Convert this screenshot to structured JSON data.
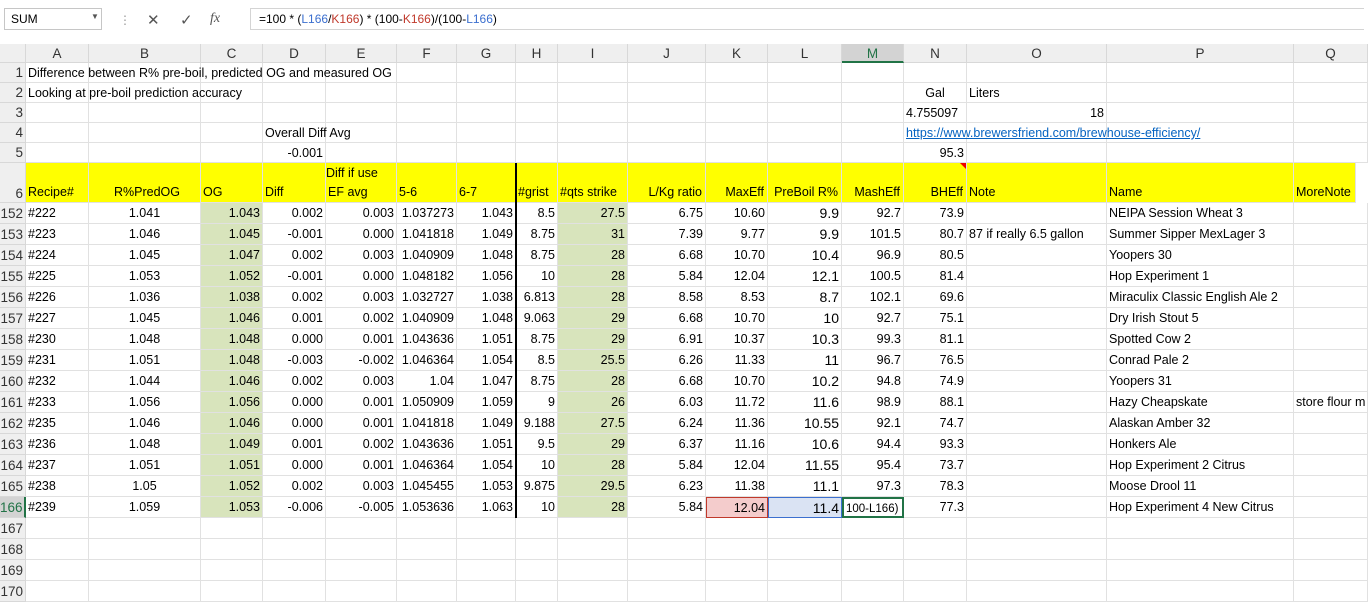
{
  "namebox": "SUM",
  "formula_bar": {
    "cancel": "✕",
    "enter": "✓",
    "fx": "fx",
    "formula_parts": [
      "=100 * (",
      "L166",
      "/",
      "K166",
      ") * (100-",
      "K166",
      ")/(100-",
      "L166",
      ")"
    ]
  },
  "columns": [
    "A",
    "B",
    "C",
    "D",
    "E",
    "F",
    "G",
    "H",
    "I",
    "J",
    "K",
    "L",
    "M",
    "N",
    "O",
    "P",
    "Q"
  ],
  "rows_top": [
    {
      "num": "1",
      "cells": {
        "A": "Difference between R% pre-boil, predicted OG and measured OG"
      }
    },
    {
      "num": "2",
      "cells": {
        "A": "Looking at pre-boil prediction accuracy"
      }
    },
    {
      "num": "3",
      "cells": {
        "N": "Gal",
        "O": "Liters"
      }
    },
    {
      "num": "4",
      "cells": {
        "N": "4.755097",
        "O": "18"
      }
    },
    {
      "num": "5",
      "cells": {
        "D": "Overall Diff Avg",
        "N": "https://www.brewersfriend.com/brewhouse-efficiency/"
      }
    },
    {
      "num": "6",
      "cells": {
        "D": "-0.001",
        "N": "95.3"
      }
    }
  ],
  "header_row": {
    "num": "6",
    "diff_if_use": "Diff if use",
    "labels": {
      "A": "Recipe#",
      "B": "R%PredOG",
      "C": "OG",
      "D": "Diff",
      "E": "EF avg",
      "F": "5-6",
      "G": "6-7",
      "H": "#grist",
      "I": "#qts strike",
      "J": "L/Kg ratio",
      "K": "MaxEff",
      "L": "PreBoil R%",
      "M": "MashEff",
      "N": "BHEff",
      "O": "Note",
      "P": "Name",
      "Q": "MoreNote"
    }
  },
  "data_rows": [
    {
      "num": "152",
      "A": "#222",
      "B": "1.041",
      "C": "1.043",
      "D": "0.002",
      "E": "0.003",
      "F": "1.037273",
      "G": "1.043",
      "H": "8.5",
      "I": "27.5",
      "J": "6.75",
      "K": "10.60",
      "L": "9.9",
      "M": "92.7",
      "N": "73.9",
      "O": "",
      "P": "NEIPA Session Wheat 3",
      "Q": ""
    },
    {
      "num": "153",
      "A": "#223",
      "B": "1.046",
      "C": "1.045",
      "D": "-0.001",
      "E": "0.000",
      "F": "1.041818",
      "G": "1.049",
      "H": "8.75",
      "I": "31",
      "J": "7.39",
      "K": "9.77",
      "L": "9.9",
      "M": "101.5",
      "N": "80.7",
      "O": "87 if really 6.5 gallon",
      "P": "Summer Sipper MexLager 3",
      "Q": ""
    },
    {
      "num": "154",
      "A": "#224",
      "B": "1.045",
      "C": "1.047",
      "D": "0.002",
      "E": "0.003",
      "F": "1.040909",
      "G": "1.048",
      "H": "8.75",
      "I": "28",
      "J": "6.68",
      "K": "10.70",
      "L": "10.4",
      "M": "96.9",
      "N": "80.5",
      "O": "",
      "P": "Yoopers 30",
      "Q": ""
    },
    {
      "num": "155",
      "A": "#225",
      "B": "1.053",
      "C": "1.052",
      "D": "-0.001",
      "E": "0.000",
      "F": "1.048182",
      "G": "1.056",
      "H": "10",
      "I": "28",
      "J": "5.84",
      "K": "12.04",
      "L": "12.1",
      "M": "100.5",
      "N": "81.4",
      "O": "",
      "P": "Hop Experiment 1",
      "Q": ""
    },
    {
      "num": "156",
      "A": "#226",
      "B": "1.036",
      "C": "1.038",
      "D": "0.002",
      "E": "0.003",
      "F": "1.032727",
      "G": "1.038",
      "H": "6.813",
      "I": "28",
      "J": "8.58",
      "K": "8.53",
      "L": "8.7",
      "M": "102.1",
      "N": "69.6",
      "O": "",
      "P": "Miraculix Classic English Ale 2",
      "Q": ""
    },
    {
      "num": "157",
      "A": "#227",
      "B": "1.045",
      "C": "1.046",
      "D": "0.001",
      "E": "0.002",
      "F": "1.040909",
      "G": "1.048",
      "H": "9.063",
      "I": "29",
      "J": "6.68",
      "K": "10.70",
      "L": "10",
      "M": "92.7",
      "N": "75.1",
      "O": "",
      "P": "Dry Irish Stout 5",
      "Q": ""
    },
    {
      "num": "158",
      "A": "#230",
      "B": "1.048",
      "C": "1.048",
      "D": "0.000",
      "E": "0.001",
      "F": "1.043636",
      "G": "1.051",
      "H": "8.75",
      "I": "29",
      "J": "6.91",
      "K": "10.37",
      "L": "10.3",
      "M": "99.3",
      "N": "81.1",
      "O": "",
      "P": "Spotted Cow 2",
      "Q": ""
    },
    {
      "num": "159",
      "A": "#231",
      "B": "1.051",
      "C": "1.048",
      "D": "-0.003",
      "E": "-0.002",
      "F": "1.046364",
      "G": "1.054",
      "H": "8.5",
      "I": "25.5",
      "J": "6.26",
      "K": "11.33",
      "L": "11",
      "M": "96.7",
      "N": "76.5",
      "O": "",
      "P": "Conrad Pale 2",
      "Q": ""
    },
    {
      "num": "160",
      "A": "#232",
      "B": "1.044",
      "C": "1.046",
      "D": "0.002",
      "E": "0.003",
      "F": "1.04",
      "G": "1.047",
      "H": "8.75",
      "I": "28",
      "J": "6.68",
      "K": "10.70",
      "L": "10.2",
      "M": "94.8",
      "N": "74.9",
      "O": "",
      "P": "Yoopers 31",
      "Q": ""
    },
    {
      "num": "161",
      "A": "#233",
      "B": "1.056",
      "C": "1.056",
      "D": "0.000",
      "E": "0.001",
      "F": "1.050909",
      "G": "1.059",
      "H": "9",
      "I": "26",
      "J": "6.03",
      "K": "11.72",
      "L": "11.6",
      "M": "98.9",
      "N": "88.1",
      "O": "",
      "P": "Hazy Cheapskate",
      "Q": "store flour m"
    },
    {
      "num": "162",
      "A": "#235",
      "B": "1.046",
      "C": "1.046",
      "D": "0.000",
      "E": "0.001",
      "F": "1.041818",
      "G": "1.049",
      "H": "9.188",
      "I": "27.5",
      "J": "6.24",
      "K": "11.36",
      "L": "10.55",
      "M": "92.1",
      "N": "74.7",
      "O": "",
      "P": "Alaskan Amber 32",
      "Q": ""
    },
    {
      "num": "163",
      "A": "#236",
      "B": "1.048",
      "C": "1.049",
      "D": "0.001",
      "E": "0.002",
      "F": "1.043636",
      "G": "1.051",
      "H": "9.5",
      "I": "29",
      "J": "6.37",
      "K": "11.16",
      "L": "10.6",
      "M": "94.4",
      "N": "93.3",
      "O": "",
      "P": "Honkers Ale",
      "Q": ""
    },
    {
      "num": "164",
      "A": "#237",
      "B": "1.051",
      "C": "1.051",
      "D": "0.000",
      "E": "0.001",
      "F": "1.046364",
      "G": "1.054",
      "H": "10",
      "I": "28",
      "J": "5.84",
      "K": "12.04",
      "L": "11.55",
      "M": "95.4",
      "N": "73.7",
      "O": "",
      "P": "Hop Experiment 2 Citrus",
      "Q": ""
    },
    {
      "num": "165",
      "A": "#238",
      "B": "1.05",
      "C": "1.052",
      "D": "0.002",
      "E": "0.003",
      "F": "1.045455",
      "G": "1.053",
      "H": "9.875",
      "I": "29.5",
      "J": "6.23",
      "K": "11.38",
      "L": "11.1",
      "M": "97.3",
      "N": "78.3",
      "O": "",
      "P": "Moose Drool 11",
      "Q": ""
    },
    {
      "num": "166",
      "A": "#239",
      "B": "1.059",
      "C": "1.053",
      "D": "-0.006",
      "E": "-0.005",
      "F": "1.053636",
      "G": "1.063",
      "H": "10",
      "I": "28",
      "J": "5.84",
      "K": "12.04",
      "L": "11.4",
      "M": "100-L166)",
      "N": "77.3",
      "O": "",
      "P": "Hop Experiment 4 New Citrus",
      "Q": ""
    }
  ],
  "empty_rows": [
    "167",
    "168",
    "169",
    "170"
  ],
  "colors": {
    "yellow": "#ffff00",
    "green_fill": "#d8e4bc",
    "select_green": "#217346",
    "ref_blue": "#3b6fcf",
    "ref_red": "#c0392b"
  }
}
